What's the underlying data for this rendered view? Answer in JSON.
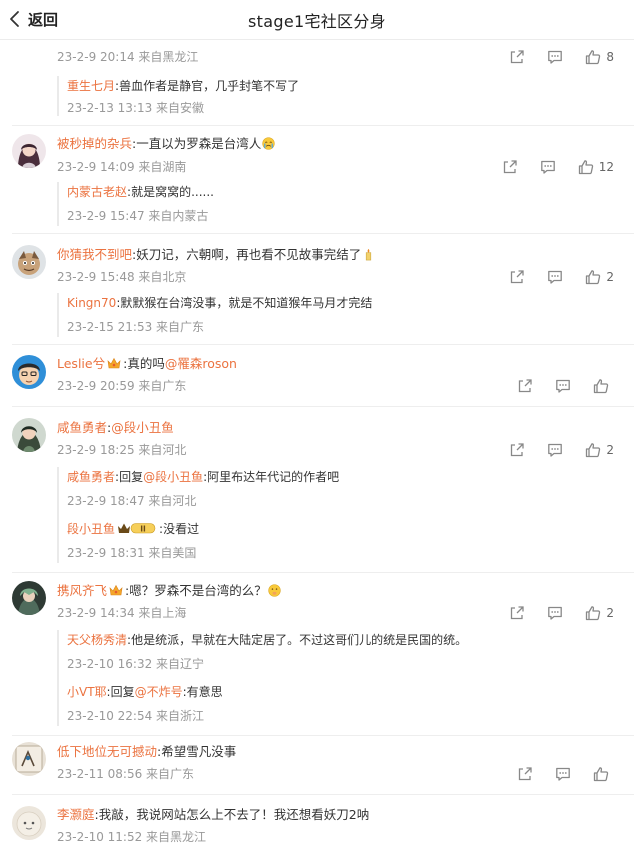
{
  "header": {
    "back_label": "返回",
    "title": "stage1宅社区分身"
  },
  "comments": [
    {
      "meta": "23-2-9 20:14 来自黑龙江",
      "likes": "8",
      "replies": [
        {
          "user": "重生七月",
          "sep": ":",
          "text": "兽血作者是静官，几乎封笔不写了",
          "meta": "23-2-13 13:13 来自安徽"
        }
      ]
    },
    {
      "user": "被秒掉的杂兵",
      "sep": ":",
      "text": "一直以为罗森是台湾人",
      "meta": "23-2-9 14:09 来自湖南",
      "likes": "12",
      "replies": [
        {
          "user": "内蒙古老赵",
          "sep": ":",
          "text": "就是窝窝的......",
          "meta": "23-2-9 15:47 来自内蒙古"
        }
      ]
    },
    {
      "user": "你猜我不到吧",
      "sep": ":",
      "text": "妖刀记，六朝啊，再也看不见故事完结了",
      "meta": "23-2-9 15:48 来自北京",
      "likes": "2",
      "replies": [
        {
          "user": "Kingn70",
          "sep": ":",
          "text": "默默猴在台湾没事，就是不知道猴年马月才完结",
          "meta": "23-2-15 21:53 来自广东"
        }
      ]
    },
    {
      "user": "Leslie兮",
      "sep": ":",
      "text": "真的吗",
      "at": "@罹森roson",
      "meta": "23-2-9 20:59 来自广东",
      "likes": ""
    },
    {
      "user": "咸鱼勇者",
      "sep": ":",
      "at": "@段小丑鱼",
      "meta": "23-2-9 18:25 来自河北",
      "likes": "2",
      "replies": [
        {
          "user": "咸鱼勇者",
          "sep": ":",
          "prefix": "回复",
          "at": "@段小丑鱼",
          "sep2": ":",
          "text": "阿里布达年代记的作者吧",
          "meta": "23-2-9 18:47 来自河北"
        },
        {
          "user": "段小丑鱼",
          "badge": "II",
          "sep": ":",
          "text": "没看过",
          "meta": "23-2-9 18:31 来自美国"
        }
      ]
    },
    {
      "user": "携风齐飞",
      "sep": ":",
      "text": "嗯？罗森不是台湾的么？",
      "meta": "23-2-9 14:34 来自上海",
      "likes": "2",
      "replies": [
        {
          "user": "天父杨秀清",
          "sep": ":",
          "text": "他是统派，早就在大陆定居了。不过这哥们儿的统是民国的统。",
          "meta": "23-2-10 16:32 来自辽宁"
        },
        {
          "user": "小VT耶",
          "sep": ":",
          "prefix": "回复",
          "at": "@不炸号",
          "sep2": ":",
          "text": "有意思",
          "meta": "23-2-10 22:54 来自浙江"
        }
      ]
    },
    {
      "user": "低下地位无可撼动",
      "sep": ":",
      "text": "希望雪凡没事",
      "meta": "23-2-11 08:56 来自广东",
      "likes": ""
    },
    {
      "user": "李灏庭",
      "sep": ":",
      "text": "我敲，我说网站怎么上不去了！我还想看妖刀2呐",
      "meta": "23-2-10 11:52 来自黑龙江",
      "likes": ""
    }
  ],
  "icons": {
    "share": "share-icon",
    "comment": "comment-icon",
    "like": "like-icon",
    "back": "chevron-left-icon"
  },
  "colors": {
    "username": "#eb7340",
    "meta": "#999999"
  }
}
